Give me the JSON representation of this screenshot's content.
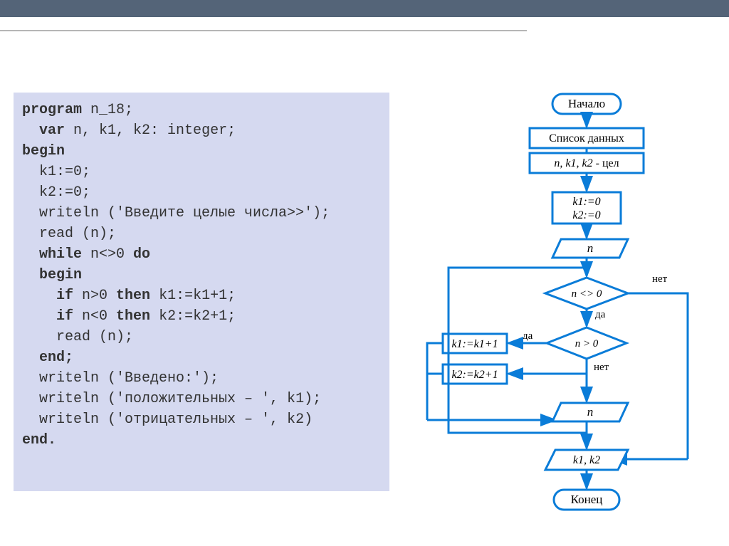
{
  "code": {
    "l1a": "program",
    "l1b": " n_18;",
    "l2a": "var",
    "l2b": " n, k1, k2: integer;",
    "l3": "begin",
    "l4": "  k1:=0;",
    "l5": "  k2:=0;",
    "l6": "  writeln ('Введите целые числа>>');",
    "l7": "  read (n);",
    "l8a": "while",
    "l8b": " n<>0 ",
    "l8c": "do",
    "l9": "begin",
    "l10a": "if",
    "l10b": " n>0 ",
    "l10c": "then",
    "l10d": " k1:=k1+1;",
    "l11a": "if",
    "l11b": " n<0 ",
    "l11c": "then",
    "l11d": " k2:=k2+1;",
    "l12": "    read (n);",
    "l13": "end;",
    "l14": "  writeln ('Введено:');",
    "l15": "  writeln ('положительных – ', k1);",
    "l16": "  writeln ('отрицательных – ', k2)",
    "l17": "end."
  },
  "flow": {
    "start": "Начало",
    "datalist": "Список данных",
    "vars": "n, k1, k2 - цел",
    "init1": "k1:=0",
    "init2": "k2:=0",
    "input_n": "n",
    "cond1": "n <> 0",
    "cond2": "n > 0",
    "yes": "да",
    "no": "нет",
    "assign1": "k1:=k1+1",
    "assign2": "k2:=k2+1",
    "input_n2": "n",
    "output": "k1, k2",
    "end": "Конец"
  }
}
